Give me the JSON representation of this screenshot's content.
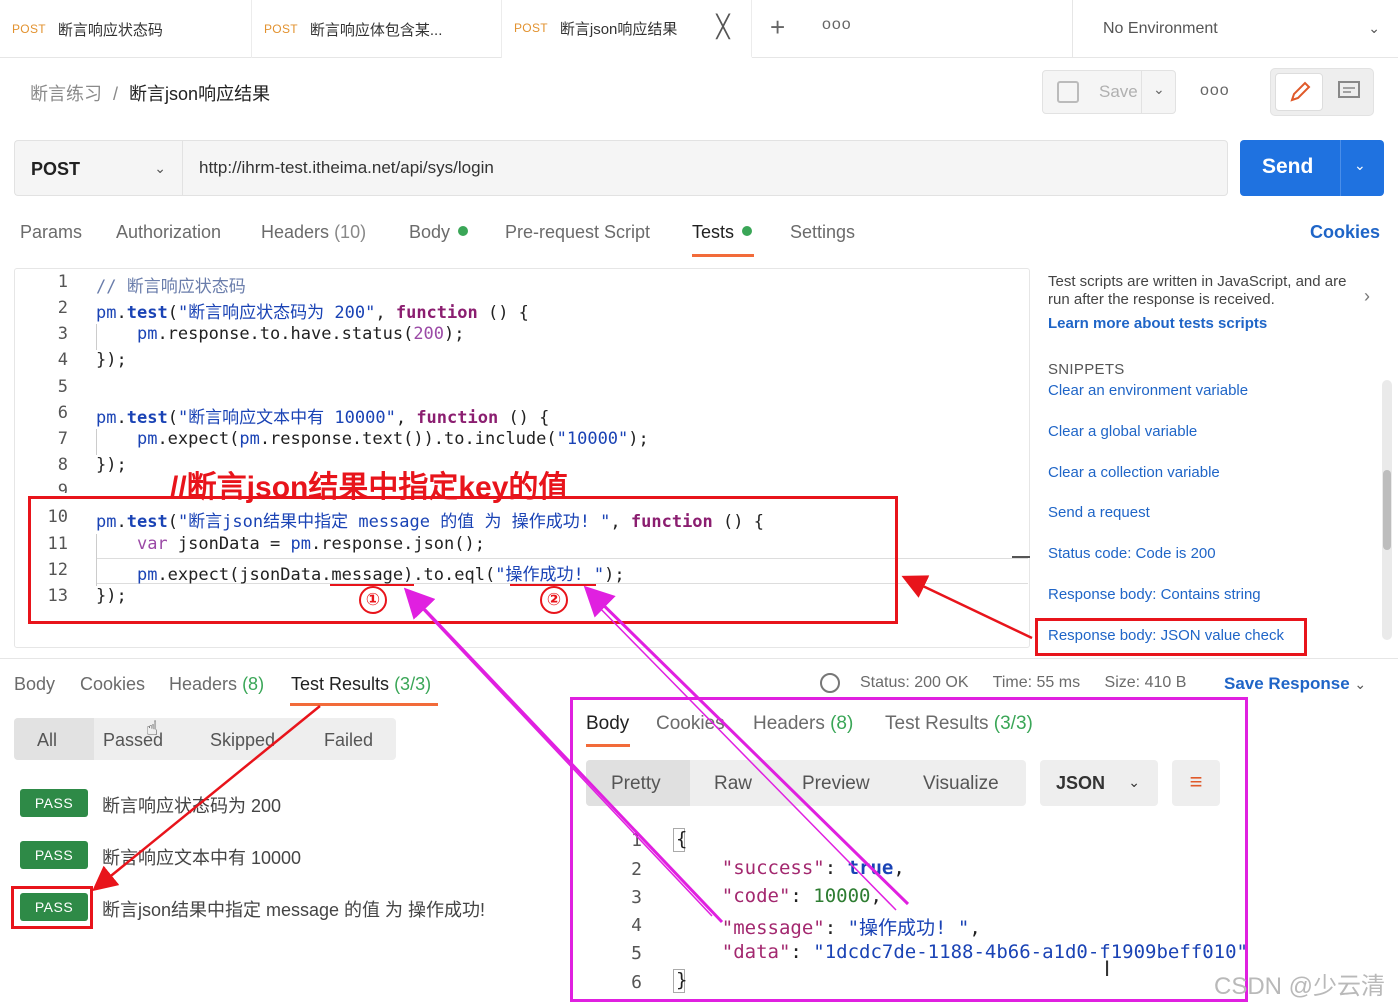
{
  "tabs": [
    {
      "method": "POST",
      "name": "断言响应状态码"
    },
    {
      "method": "POST",
      "name": "断言响应体包含某..."
    },
    {
      "method": "POST",
      "name": "断言json响应结果"
    }
  ],
  "tab_close": "╳",
  "tab_add": "+",
  "tab_more": "ooo",
  "environment": "No Environment",
  "breadcrumb": {
    "parent": "断言练习",
    "separator": "/",
    "current": "断言json响应结果"
  },
  "toolbar": {
    "save_label": "Save",
    "more": "ooo"
  },
  "request": {
    "method": "POST",
    "url": "http://ihrm-test.itheima.net/api/sys/login",
    "send_label": "Send"
  },
  "request_tabs": {
    "params": "Params",
    "authorization": "Authorization",
    "headers": "Headers",
    "headers_count": "(10)",
    "body": "Body",
    "prerequest": "Pre-request Script",
    "tests": "Tests",
    "settings": "Settings",
    "cookies": "Cookies"
  },
  "editor": {
    "line_numbers": [
      "1",
      "2",
      "3",
      "4",
      "5",
      "6",
      "7",
      "8",
      "9",
      "10",
      "11",
      "12",
      "13"
    ]
  },
  "annotations": {
    "title": "//断言json结果中指定key的值",
    "circle1": "①",
    "circle2": "②"
  },
  "side_panel": {
    "description": "Test scripts are written in JavaScript, and are run after the response is received.",
    "learn_more": "Learn more about tests scripts",
    "snippets_header": "SNIPPETS",
    "snippets": [
      "Clear an environment variable",
      "Clear a global variable",
      "Clear a collection variable",
      "Send a request",
      "Status code: Code is 200",
      "Response body: Contains string",
      "Response body: JSON value check"
    ]
  },
  "response": {
    "tabs": {
      "body": "Body",
      "cookies": "Cookies",
      "headers": "Headers",
      "headers_count": "(8)",
      "test_results": "Test Results",
      "test_results_count": "(3/3)"
    },
    "status": "Status: 200 OK",
    "time": "Time: 55 ms",
    "size": "Size: 410 B",
    "save_response": "Save Response",
    "filters": {
      "all": "All",
      "passed": "Passed",
      "skipped": "Skipped",
      "failed": "Failed"
    },
    "results": [
      {
        "status": "PASS",
        "name": "断言响应状态码为 200"
      },
      {
        "status": "PASS",
        "name": "断言响应文本中有 10000"
      },
      {
        "status": "PASS",
        "name": "断言json结果中指定 message 的值 为 操作成功!"
      }
    ]
  },
  "inset": {
    "tabs": {
      "body": "Body",
      "cookies": "Cookies",
      "headers": "Headers",
      "headers_count": "(8)",
      "test_results": "Test Results",
      "test_results_count": "(3/3)"
    },
    "formats": {
      "pretty": "Pretty",
      "raw": "Raw",
      "preview": "Preview",
      "visualize": "Visualize"
    },
    "language": "JSON",
    "line_numbers": [
      "1",
      "2",
      "3",
      "4",
      "5",
      "6"
    ]
  },
  "watermark": "CSDN @少云清",
  "colors": {
    "accent": "#f26b3a",
    "send": "#1f72e0",
    "link": "#1f65c7",
    "pass": "#2e8a47",
    "annotation_red": "#e8141b",
    "annotation_magenta": "#e020e0"
  }
}
